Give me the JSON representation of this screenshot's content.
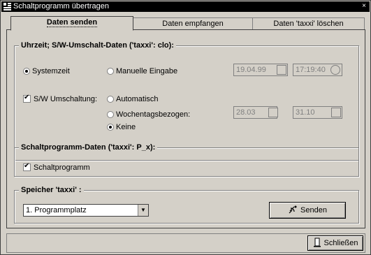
{
  "window": {
    "title": "Schaltprogramm übertragen",
    "close_glyph": "×"
  },
  "tabs": [
    {
      "label": "Daten senden"
    },
    {
      "label": "Daten empfangen"
    },
    {
      "label": "Daten 'taxxi' löschen"
    }
  ],
  "time_group": {
    "title": "Uhrzeit; S/W-Umschalt-Daten ('taxxi': clo):",
    "systemzeit": "Systemzeit",
    "manuelle": "Manuelle Eingabe",
    "date_value": "19.04.99",
    "time_value": "17:19:40",
    "sw_label": "S/W Umschaltung:",
    "automatisch": "Automatisch",
    "wochentag": "Wochentagsbezogen:",
    "keine": "Keine",
    "week_start": "28.03",
    "week_end": "31.10"
  },
  "program_group": {
    "title": "Schaltprogramm-Daten ('taxxi': P_x):",
    "checkbox": "Schaltprogramm"
  },
  "memory_group": {
    "title": "Speicher 'taxxi' :",
    "selected": "1. Programmplatz",
    "send": "Senden"
  },
  "footer": {
    "close": "Schließen"
  },
  "colors": {
    "titlebar": "#000000",
    "face": "#d4d0c8"
  }
}
